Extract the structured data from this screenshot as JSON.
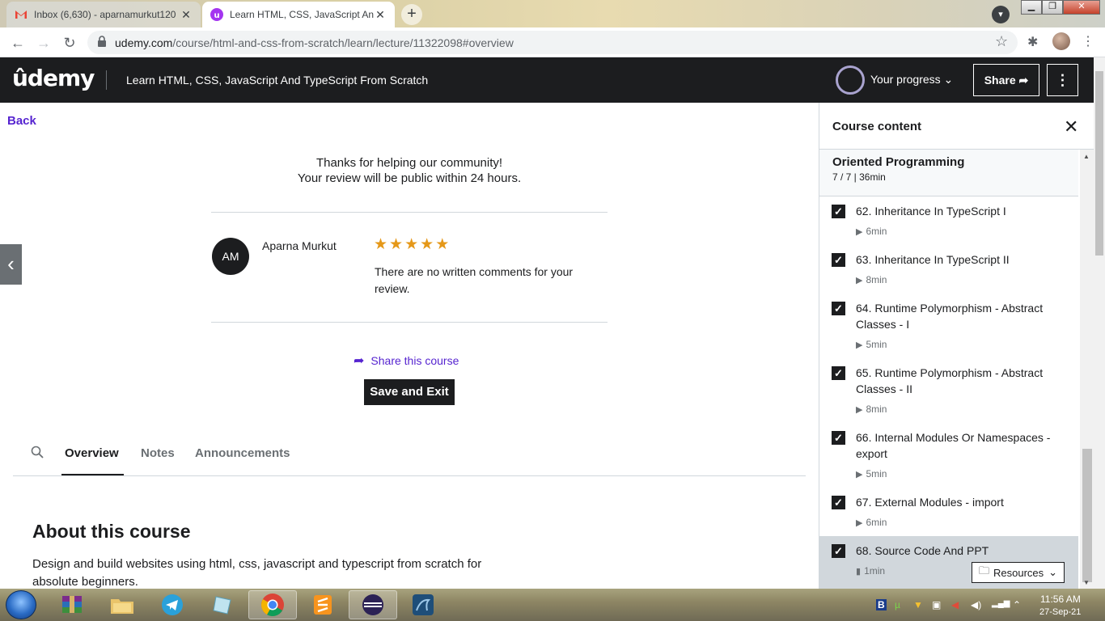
{
  "browser": {
    "tabs": [
      {
        "title": "Inbox (6,630) - aparnamurkut120",
        "icon": "gmail-icon"
      },
      {
        "title": "Learn HTML, CSS, JavaScript And",
        "icon": "udemy-icon"
      }
    ],
    "url_host": "udemy.com",
    "url_path": "/course/html-and-css-from-scratch/learn/lecture/11322098#overview"
  },
  "header": {
    "logo": "ûdemy",
    "course_title": "Learn HTML, CSS, JavaScript And TypeScript From Scratch",
    "progress_label": "Your progress",
    "share_label": "Share"
  },
  "main": {
    "back_label": "Back",
    "thanks_line1": "Thanks for helping our community!",
    "thanks_line2": "Your review will be public within 24 hours.",
    "avatar_initials": "AM",
    "reviewer_name": "Aparna Murkut",
    "rating": 5,
    "review_text": "There are no written comments for your review.",
    "share_course_label": "Share this course",
    "save_exit_label": "Save and Exit",
    "tabs": [
      "Overview",
      "Notes",
      "Announcements"
    ],
    "about_title": "About this course",
    "about_text": "Design and build websites using html, css, javascript and typescript from scratch for absolute beginners."
  },
  "sidebar": {
    "title": "Course content",
    "section_title": "Oriented Programming",
    "section_meta": "7 / 7 | 36min",
    "lectures": [
      {
        "title": "62. Inheritance In TypeScript I",
        "duration": "6min",
        "type": "video"
      },
      {
        "title": "63. Inheritance In TypeScript II",
        "duration": "8min",
        "type": "video"
      },
      {
        "title": "64. Runtime Polymorphism - Abstract Classes - I",
        "duration": "5min",
        "type": "video"
      },
      {
        "title": "65. Runtime Polymorphism - Abstract Classes - II",
        "duration": "8min",
        "type": "video"
      },
      {
        "title": "66. Internal Modules Or Namespaces - export",
        "duration": "5min",
        "type": "video"
      },
      {
        "title": "67. External Modules - import",
        "duration": "6min",
        "type": "video"
      },
      {
        "title": "68. Source Code And PPT",
        "duration": "1min",
        "type": "file"
      }
    ],
    "resources_label": "Resources"
  },
  "taskbar": {
    "time": "11:56 AM",
    "date": "27-Sep-21"
  },
  "colors": {
    "brand_purple": "#5624d0",
    "header_bg": "#1c1d1f",
    "star": "#e59819"
  }
}
